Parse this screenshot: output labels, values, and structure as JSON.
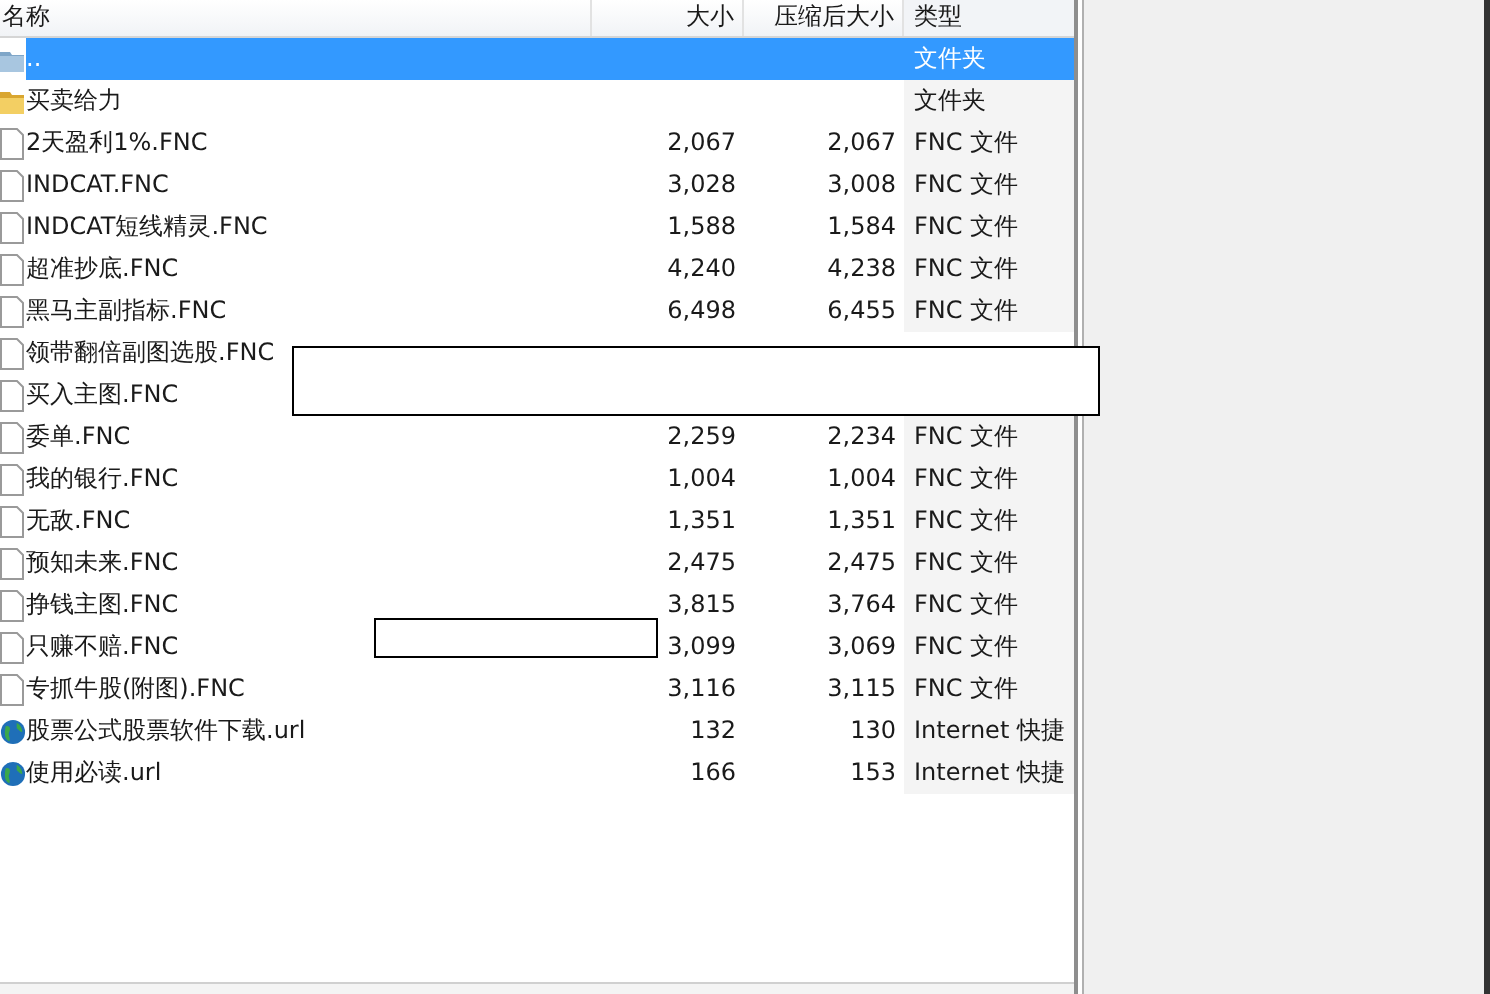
{
  "table": {
    "columns": [
      {
        "label": "名称"
      },
      {
        "label": "大小"
      },
      {
        "label": "压缩后大小"
      },
      {
        "label": "类型"
      }
    ],
    "rows": [
      {
        "kind": "parent",
        "name": "..",
        "type": "文件夹",
        "selected": true
      },
      {
        "kind": "folder",
        "name": "买卖给力",
        "type": "文件夹",
        "selected": false
      },
      {
        "kind": "file",
        "name": "2天盈利1%.FNC",
        "size": "2,067",
        "packed": "2,067",
        "type": "FNC 文件",
        "selected": false
      },
      {
        "kind": "file",
        "name": "INDCAT.FNC",
        "size": "3,028",
        "packed": "3,008",
        "type": "FNC 文件",
        "selected": false
      },
      {
        "kind": "file",
        "name": "INDCAT短线精灵.FNC",
        "size": "1,588",
        "packed": "1,584",
        "type": "FNC 文件",
        "selected": false
      },
      {
        "kind": "file",
        "name": "超准抄底.FNC",
        "size": "4,240",
        "packed": "4,238",
        "type": "FNC 文件",
        "selected": false
      },
      {
        "kind": "file",
        "name": "黑马主副指标.FNC",
        "size": "6,498",
        "packed": "6,455",
        "type": "FNC 文件",
        "selected": false
      },
      {
        "kind": "file",
        "name": "领带翻倍副图选股.FNC",
        "selected": false
      },
      {
        "kind": "file",
        "name": "买入主图.FNC",
        "selected": false
      },
      {
        "kind": "file",
        "name": "委单.FNC",
        "size": "2,259",
        "packed": "2,234",
        "type": "FNC 文件",
        "selected": false
      },
      {
        "kind": "file",
        "name": "我的银行.FNC",
        "size": "1,004",
        "packed": "1,004",
        "type": "FNC 文件",
        "selected": false
      },
      {
        "kind": "file",
        "name": "无敌.FNC",
        "size": "1,351",
        "packed": "1,351",
        "type": "FNC 文件",
        "selected": false
      },
      {
        "kind": "file",
        "name": "预知未来.FNC",
        "size": "2,475",
        "packed": "2,475",
        "type": "FNC 文件",
        "selected": false
      },
      {
        "kind": "file",
        "name": "挣钱主图.FNC",
        "size": "3,815",
        "packed": "3,764",
        "type": "FNC 文件",
        "selected": false
      },
      {
        "kind": "file",
        "name": "只赚不赔.FNC",
        "size": "3,099",
        "packed": "3,069",
        "type": "FNC 文件",
        "selected": false
      },
      {
        "kind": "file",
        "name": "专抓牛股(附图).FNC",
        "size": "3,116",
        "packed": "3,115",
        "type": "FNC 文件",
        "selected": false
      },
      {
        "kind": "link",
        "name": "股票公式股票软件下载.url",
        "size": "132",
        "packed": "130",
        "type": "Internet 快捷",
        "selected": false
      },
      {
        "kind": "link",
        "name": "使用必读.url",
        "size": "166",
        "packed": "153",
        "type": "Internet 快捷",
        "selected": false
      }
    ]
  }
}
